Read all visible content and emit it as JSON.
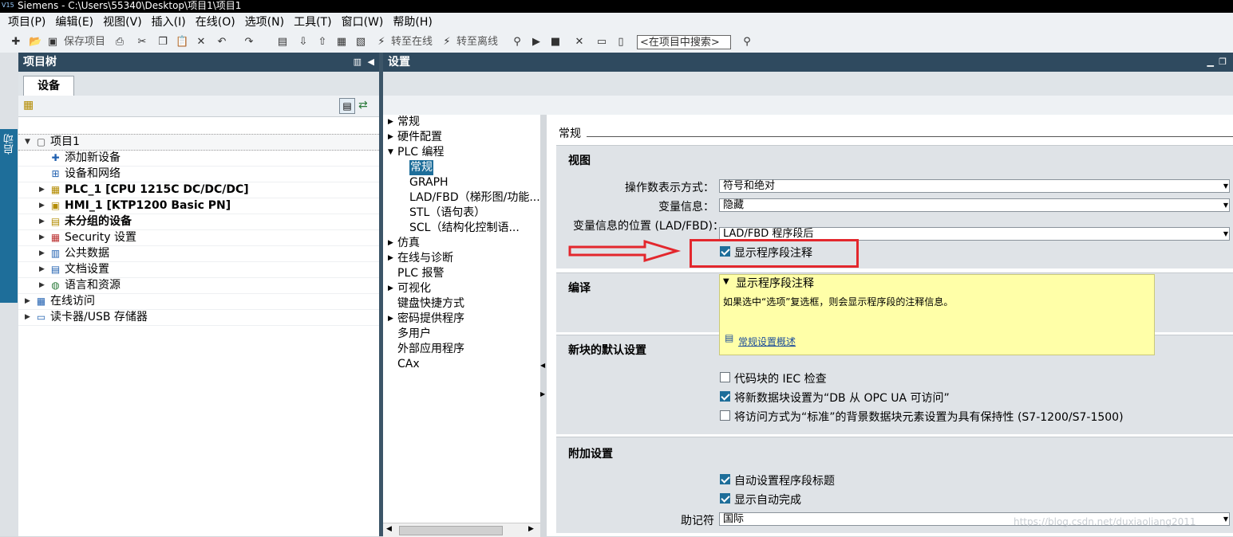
{
  "window": {
    "title": "Siemens  -  C:\\Users\\55340\\Desktop\\项目1\\项目1"
  },
  "menu": [
    "项目(P)",
    "编辑(E)",
    "视图(V)",
    "插入(I)",
    "在线(O)",
    "选项(N)",
    "工具(T)",
    "窗口(W)",
    "帮助(H)"
  ],
  "toolbar": {
    "save_label": "保存项目",
    "go_online": "转至在线",
    "go_offline": "转至离线",
    "search_placeholder": "<在项目中搜索>"
  },
  "rail": {
    "start_tab": "启动"
  },
  "project_tree": {
    "title": "项目树",
    "tab": "设备",
    "items": [
      {
        "label": "项目1",
        "level": 0,
        "expander": "open",
        "icon": "project-icon"
      },
      {
        "label": "添加新设备",
        "level": 1,
        "expander": "none",
        "icon": "add-device-icon"
      },
      {
        "label": "设备和网络",
        "level": 1,
        "expander": "none",
        "icon": "network-icon"
      },
      {
        "label": "PLC_1 [CPU 1215C DC/DC/DC]",
        "level": 1,
        "expander": "closed",
        "icon": "plc-icon",
        "bold": true
      },
      {
        "label": "HMI_1 [KTP1200 Basic PN]",
        "level": 1,
        "expander": "closed",
        "icon": "hmi-icon",
        "bold": true
      },
      {
        "label": "未分组的设备",
        "level": 1,
        "expander": "closed",
        "icon": "folder-icon",
        "bold": true
      },
      {
        "label": "Security 设置",
        "level": 1,
        "expander": "closed",
        "icon": "security-icon"
      },
      {
        "label": "公共数据",
        "level": 1,
        "expander": "closed",
        "icon": "common-data-icon"
      },
      {
        "label": "文档设置",
        "level": 1,
        "expander": "closed",
        "icon": "document-icon"
      },
      {
        "label": "语言和资源",
        "level": 1,
        "expander": "closed",
        "icon": "language-icon"
      },
      {
        "label": "在线访问",
        "level": 0,
        "expander": "closed",
        "icon": "online-access-icon"
      },
      {
        "label": "读卡器/USB 存储器",
        "level": 0,
        "expander": "closed",
        "icon": "card-reader-icon"
      }
    ]
  },
  "settings": {
    "title": "设置",
    "nav": [
      {
        "label": "常规",
        "level": 0,
        "expander": "closed"
      },
      {
        "label": "硬件配置",
        "level": 0,
        "expander": "closed"
      },
      {
        "label": "PLC 编程",
        "level": 0,
        "expander": "open"
      },
      {
        "label": "常规",
        "level": 1,
        "expander": "none",
        "selected": true
      },
      {
        "label": "GRAPH",
        "level": 1,
        "expander": "none"
      },
      {
        "label": "LAD/FBD（梯形图/功能...",
        "level": 1,
        "expander": "none"
      },
      {
        "label": "STL（语句表）",
        "level": 1,
        "expander": "none"
      },
      {
        "label": "SCL（结构化控制语...",
        "level": 1,
        "expander": "none"
      },
      {
        "label": "仿真",
        "level": 0,
        "expander": "closed"
      },
      {
        "label": "在线与诊断",
        "level": 0,
        "expander": "closed"
      },
      {
        "label": "PLC 报警",
        "level": 0,
        "expander": "none"
      },
      {
        "label": "可视化",
        "level": 0,
        "expander": "closed"
      },
      {
        "label": "键盘快捷方式",
        "level": 0,
        "expander": "none"
      },
      {
        "label": "密码提供程序",
        "level": 0,
        "expander": "closed"
      },
      {
        "label": "多用户",
        "level": 0,
        "expander": "none"
      },
      {
        "label": "外部应用程序",
        "level": 0,
        "expander": "none"
      },
      {
        "label": "CAx",
        "level": 0,
        "expander": "none"
      }
    ],
    "page_heading": "常规",
    "view": {
      "heading": "视图",
      "operand_label": "操作数表示方式：",
      "operand_value": "符号和绝对",
      "taginfo_label": "变量信息：",
      "taginfo_value": "隐藏",
      "taginfo_pos_label": "变量信息的位置 (LAD/FBD)：",
      "taginfo_pos_value": "LAD/FBD 程序段后",
      "show_comments_label": "显示程序段注释",
      "show_comments_checked": true
    },
    "compile": {
      "heading": "编译"
    },
    "tooltip": {
      "title": "显示程序段注释",
      "body": "如果选中“选项”复选框，则会显示程序段的注释信息。",
      "link": "常规设置概述"
    },
    "new_block": {
      "heading": "新块的默认设置",
      "options": [
        {
          "label": "代码块的 IEC 检查",
          "checked": false
        },
        {
          "label": "将新数据块设置为“DB 从 OPC UA 可访问”",
          "checked": true
        },
        {
          "label": "将访问方式为“标准”的背景数据块元素设置为具有保持性 (S7-1200/S7-1500)",
          "checked": false
        }
      ]
    },
    "additional": {
      "heading": "附加设置",
      "options": [
        {
          "label": "自动设置程序段标题",
          "checked": true
        },
        {
          "label": "显示自动完成",
          "checked": true
        }
      ],
      "mnemonic_label": "助记符",
      "mnemonic_value": "国际"
    }
  },
  "annotation": {
    "color": "#e3272d"
  },
  "watermark": "https://blog.csdn.net/duxiaoliang2011"
}
